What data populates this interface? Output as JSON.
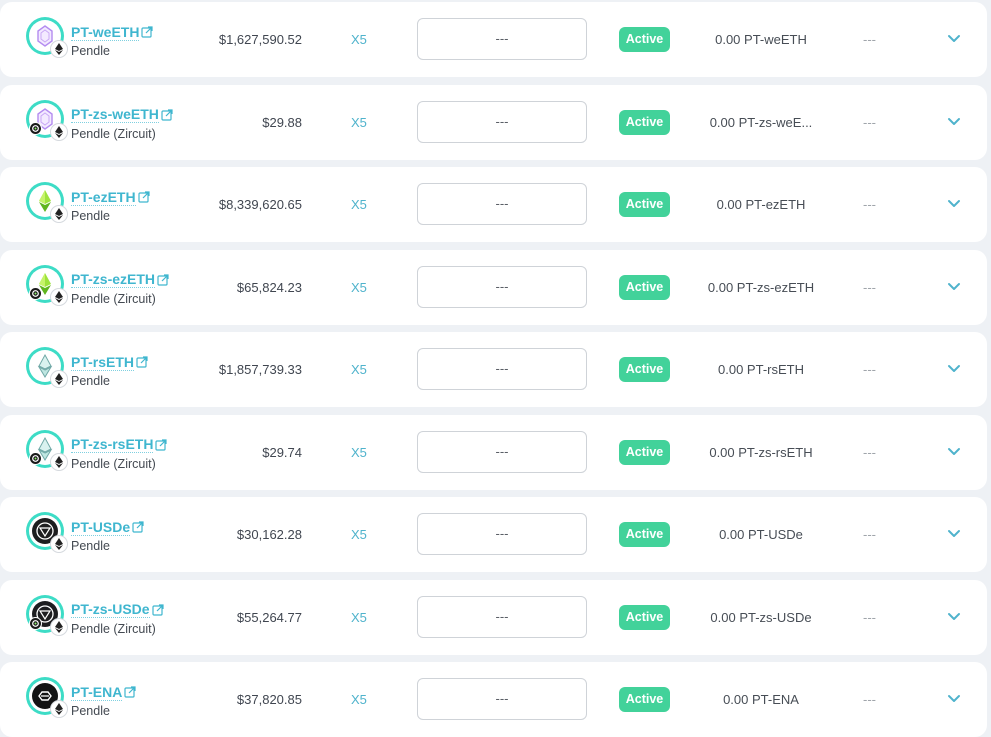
{
  "colors": {
    "accent": "#3fb6cf",
    "status_active": "#42d29a",
    "logo_ring": "#3ddcc6",
    "page_bg": "#eef1f5"
  },
  "rows": [
    {
      "name": "PT-weETH",
      "protocol": "Pendle",
      "tvl": "$1,627,590.52",
      "multiplier": "X5",
      "input": "---",
      "status": "Active",
      "balance": "0.00 PT-weETH",
      "extra": "---",
      "token_icon": "weeth-icon",
      "zircuit": false
    },
    {
      "name": "PT-zs-weETH",
      "protocol": "Pendle (Zircuit)",
      "tvl": "$29.88",
      "multiplier": "X5",
      "input": "---",
      "status": "Active",
      "balance": "0.00 PT-zs-weE...",
      "extra": "---",
      "token_icon": "weeth-icon",
      "zircuit": true
    },
    {
      "name": "PT-ezETH",
      "protocol": "Pendle",
      "tvl": "$8,339,620.65",
      "multiplier": "X5",
      "input": "---",
      "status": "Active",
      "balance": "0.00 PT-ezETH",
      "extra": "---",
      "token_icon": "ezeth-icon",
      "zircuit": false
    },
    {
      "name": "PT-zs-ezETH",
      "protocol": "Pendle (Zircuit)",
      "tvl": "$65,824.23",
      "multiplier": "X5",
      "input": "---",
      "status": "Active",
      "balance": "0.00 PT-zs-ezETH",
      "extra": "---",
      "token_icon": "ezeth-icon",
      "zircuit": true
    },
    {
      "name": "PT-rsETH",
      "protocol": "Pendle",
      "tvl": "$1,857,739.33",
      "multiplier": "X5",
      "input": "---",
      "status": "Active",
      "balance": "0.00 PT-rsETH",
      "extra": "---",
      "token_icon": "rseth-icon",
      "zircuit": false
    },
    {
      "name": "PT-zs-rsETH",
      "protocol": "Pendle (Zircuit)",
      "tvl": "$29.74",
      "multiplier": "X5",
      "input": "---",
      "status": "Active",
      "balance": "0.00 PT-zs-rsETH",
      "extra": "---",
      "token_icon": "rseth-icon",
      "zircuit": true
    },
    {
      "name": "PT-USDe",
      "protocol": "Pendle",
      "tvl": "$30,162.28",
      "multiplier": "X5",
      "input": "---",
      "status": "Active",
      "balance": "0.00 PT-USDe",
      "extra": "---",
      "token_icon": "usde-icon",
      "zircuit": false
    },
    {
      "name": "PT-zs-USDe",
      "protocol": "Pendle (Zircuit)",
      "tvl": "$55,264.77",
      "multiplier": "X5",
      "input": "---",
      "status": "Active",
      "balance": "0.00 PT-zs-USDe",
      "extra": "---",
      "token_icon": "usde-icon",
      "zircuit": true
    },
    {
      "name": "PT-ENA",
      "protocol": "Pendle",
      "tvl": "$37,820.85",
      "multiplier": "X5",
      "input": "---",
      "status": "Active",
      "balance": "0.00 PT-ENA",
      "extra": "---",
      "token_icon": "ena-icon",
      "zircuit": false
    }
  ]
}
